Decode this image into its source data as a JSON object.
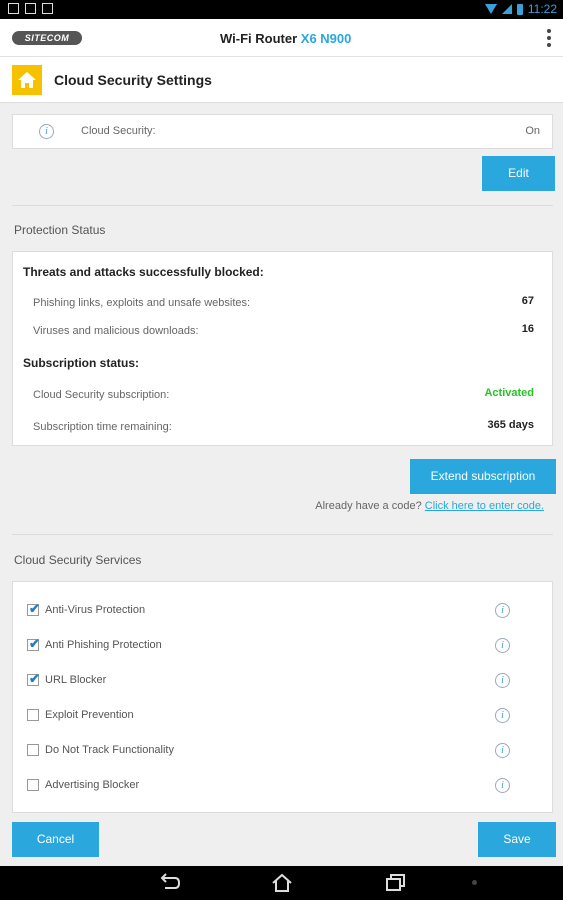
{
  "statusbar": {
    "time": "11:22"
  },
  "app": {
    "logo": "SITECOM",
    "title_prefix": "Wi-Fi Router",
    "title_model": "X6 N900"
  },
  "page": {
    "title": "Cloud Security Settings"
  },
  "cloud_security": {
    "label": "Cloud Security:",
    "value": "On",
    "edit_label": "Edit"
  },
  "protection": {
    "section_label": "Protection Status",
    "threats_heading": "Threats and attacks successfully blocked:",
    "threats": [
      {
        "label": "Phishing links, exploits and unsafe websites:",
        "value": "67"
      },
      {
        "label": "Viruses and malicious downloads:",
        "value": "16"
      }
    ],
    "subscription_heading": "Subscription status:",
    "subscription": [
      {
        "label": "Cloud Security subscription:",
        "value": "Activated"
      },
      {
        "label": "Subscription time remaining:",
        "value": "365 days"
      }
    ],
    "extend_label": "Extend subscription",
    "code_prompt": "Already have a code?",
    "code_link": "Click here to enter code."
  },
  "services": {
    "section_label": "Cloud Security Services",
    "items": [
      {
        "label": "Anti-Virus Protection",
        "checked": true
      },
      {
        "label": "Anti Phishing Protection",
        "checked": true
      },
      {
        "label": "URL Blocker",
        "checked": true
      },
      {
        "label": "Exploit Prevention",
        "checked": false
      },
      {
        "label": "Do Not Track Functionality",
        "checked": false
      },
      {
        "label": "Advertising Blocker",
        "checked": false
      }
    ]
  },
  "actions": {
    "cancel_label": "Cancel",
    "save_label": "Save"
  },
  "colors": {
    "accent": "#2aa7dc",
    "activated": "#27c327",
    "home_icon_bg": "#f6c200"
  }
}
